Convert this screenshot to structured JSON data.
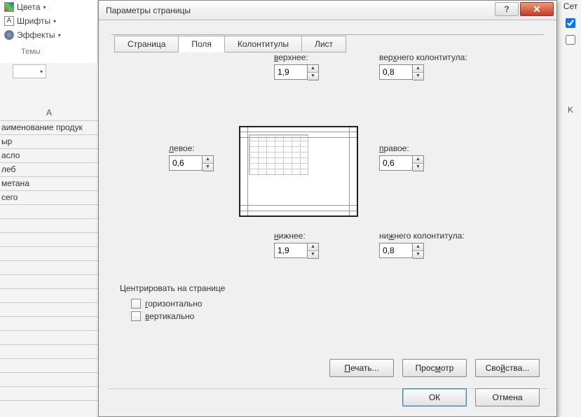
{
  "ribbon": {
    "colors": "Цвета",
    "fonts": "Шрифты",
    "effects": "Эффекты",
    "fonts_glyph": "А",
    "themes_label": "Темы",
    "col_letter_k": "K"
  },
  "right_panel": {
    "label": "Сет"
  },
  "sheet": {
    "col_letter": "A",
    "rows": [
      "аименование продук",
      "ыр",
      "асло",
      "леб",
      "метана",
      "сего",
      "",
      "",
      "",
      "",
      "",
      "",
      "",
      "",
      "",
      "",
      "",
      "",
      "",
      ""
    ]
  },
  "dialog": {
    "title": "Параметры страницы",
    "tabs": {
      "page": "Страница",
      "fields": "Поля",
      "headers": "Колонтитулы",
      "sheet": "Лист"
    },
    "margins": {
      "top_label": "верхнее:",
      "top_value": "1,9",
      "header_label": "верхнего колонтитула:",
      "header_value": "0,8",
      "left_label": "левое:",
      "left_value": "0,6",
      "right_label": "правое:",
      "right_value": "0,6",
      "bottom_label": "нижнее:",
      "bottom_value": "1,9",
      "footer_label": "нижнего колонтитула:",
      "footer_value": "0,8"
    },
    "center": {
      "group_label": "Центрировать на странице",
      "horizontal": "горизонтально",
      "vertical": "вертикально"
    },
    "buttons": {
      "print": "Печать...",
      "preview": "Просмотр",
      "properties": "Свойства...",
      "ok": "ОК",
      "cancel": "Отмена"
    }
  }
}
